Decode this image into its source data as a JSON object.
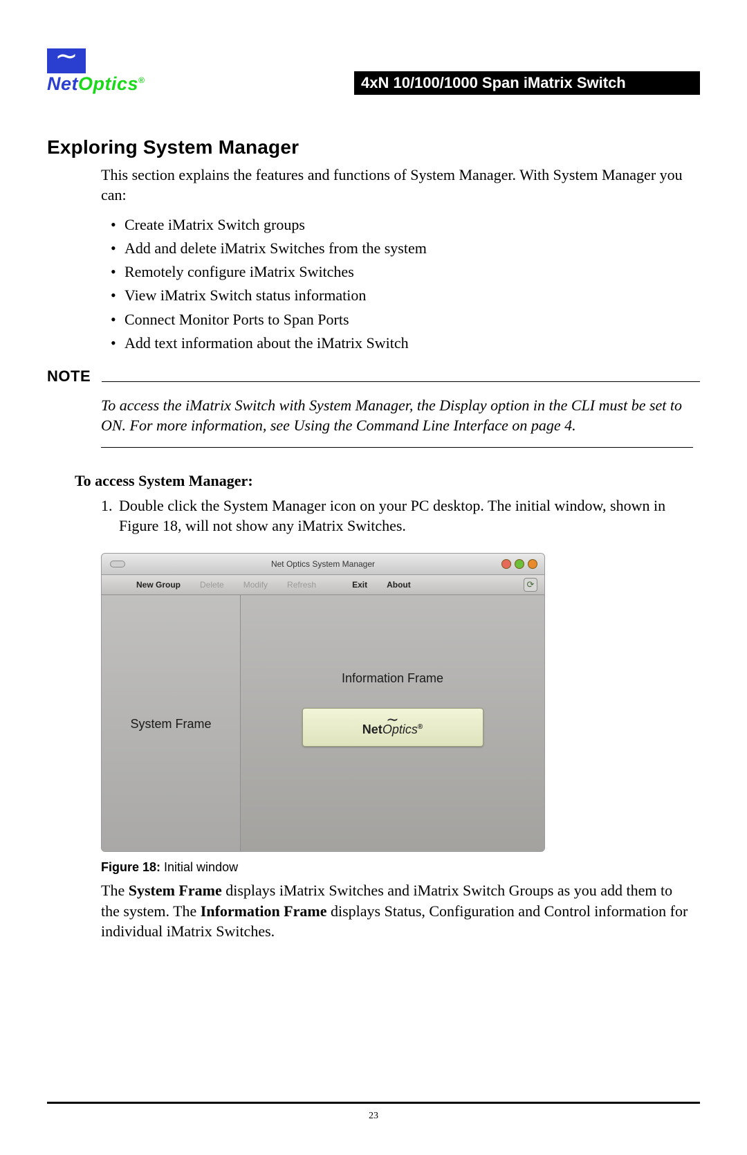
{
  "header": {
    "logo_net": "Net",
    "logo_optics": "Optics",
    "product_bar": "4xN 10/100/1000 Span iMatrix Switch"
  },
  "section_title": "Exploring System Manager",
  "intro": "This section explains the features and functions of System Manager. With System Manager you can:",
  "bullets": {
    "b0": "Create iMatrix Switch groups",
    "b1": "Add and delete iMatrix Switches from the system",
    "b2": "Remotely configure iMatrix Switches",
    "b3": "View iMatrix Switch status information",
    "b4": "Connect Monitor Ports to Span Ports",
    "b5": "Add text information about the iMatrix Switch"
  },
  "note_label": "Note",
  "note_text": "To access the iMatrix Switch with System Manager, the Display option in the CLI must be set to ON. For more information, see Using the Command Line Interface on page 4.",
  "access_heading": "To access System Manager:",
  "steps": {
    "s1": "Double click the System Manager icon on your PC desktop. The initial window, shown in Figure 18, will not show any iMatrix Switches."
  },
  "app": {
    "title": "Net Optics System Manager",
    "toolbar": {
      "new_group": "New Group",
      "delete": "Delete",
      "modify": "Modify",
      "refresh": "Refresh",
      "exit": "Exit",
      "about": "About"
    },
    "system_frame_label": "System Frame",
    "info_frame_label": "Information Frame",
    "badge_net": "Net",
    "badge_optics": "Optics"
  },
  "figure_caption_bold": "Figure 18:",
  "figure_caption_rest": " Initial window",
  "after_figure_pre": "The ",
  "after_figure_bold1": "System Frame",
  "after_figure_mid1": " displays iMatrix Switches and iMatrix Switch Groups as you add them to the system. The ",
  "after_figure_bold2": "Information Frame",
  "after_figure_post": " displays Status, Configuration and Control information for individual iMatrix Switches.",
  "page_number": "23"
}
